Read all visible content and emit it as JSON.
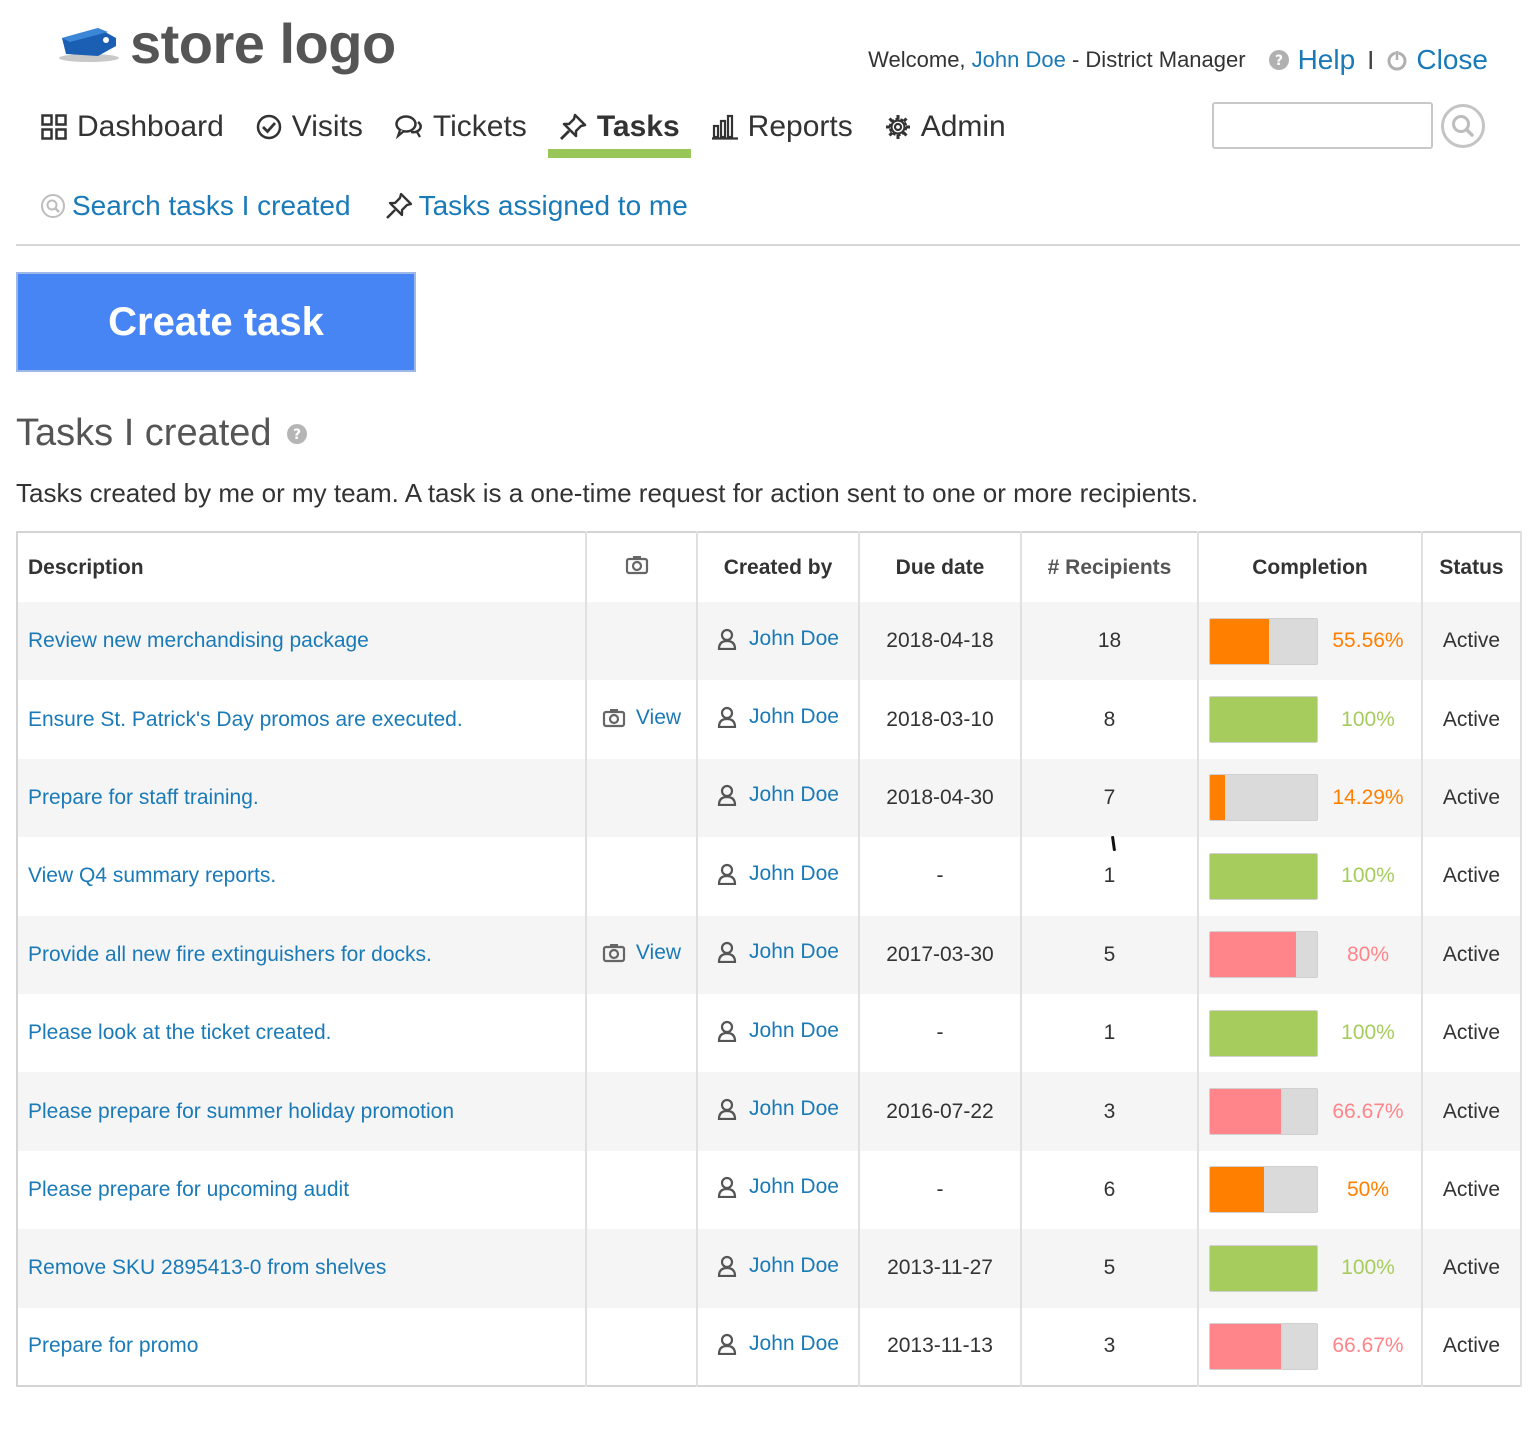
{
  "header": {
    "logo_text": "store logo",
    "welcome_prefix": "Welcome,",
    "user_name": "John Doe",
    "user_role": "- District Manager",
    "help_label": "Help",
    "separator": "I",
    "close_label": "Close"
  },
  "nav": {
    "items": [
      {
        "label": "Dashboard",
        "icon": "dashboard-grid-icon"
      },
      {
        "label": "Visits",
        "icon": "check-circle-icon"
      },
      {
        "label": "Tickets",
        "icon": "chat-bubbles-icon"
      },
      {
        "label": "Tasks",
        "icon": "pushpin-icon",
        "active": true
      },
      {
        "label": "Reports",
        "icon": "bar-chart-icon"
      },
      {
        "label": "Admin",
        "icon": "gear-icon"
      }
    ],
    "search_value": ""
  },
  "subnav": {
    "search_created_label": "Search tasks I created",
    "assigned_label": "Tasks assigned to me"
  },
  "create_button_label": "Create task",
  "section": {
    "title": "Tasks I created",
    "description": "Tasks created by me or my team. A task is a one-time request for action sent to one or more recipients."
  },
  "table": {
    "headers": {
      "description": "Description",
      "created_by": "Created by",
      "due_date": "Due date",
      "recipients": "# Recipients",
      "completion": "Completion",
      "status": "Status"
    },
    "colors": {
      "orange": "#ff7f00",
      "green": "#a5cc5c",
      "red": "#ff858a",
      "bar_bg": "#dadada"
    },
    "rows": [
      {
        "description": "Review new merchandising package",
        "view": "",
        "created_by": "John Doe",
        "due": "2018-04-18",
        "recipients": "18",
        "completion": 55.56,
        "completion_text": "55.56%",
        "color": "orange",
        "status": "Active"
      },
      {
        "description": "Ensure St. Patrick's Day promos are executed.",
        "view": "View",
        "created_by": "John Doe",
        "due": "2018-03-10",
        "recipients": "8",
        "completion": 100,
        "completion_text": "100%",
        "color": "green",
        "status": "Active"
      },
      {
        "description": "Prepare for staff training.",
        "view": "",
        "created_by": "John Doe",
        "due": "2018-04-30",
        "recipients": "7",
        "completion": 14.29,
        "completion_text": "14.29%",
        "color": "orange",
        "status": "Active"
      },
      {
        "description": "View Q4 summary reports.",
        "view": "",
        "created_by": "John Doe",
        "due": "-",
        "recipients": "1",
        "completion": 100,
        "completion_text": "100%",
        "color": "green",
        "status": "Active"
      },
      {
        "description": "Provide all new fire extinguishers for docks.",
        "view": "View",
        "created_by": "John Doe",
        "due": "2017-03-30",
        "recipients": "5",
        "completion": 80,
        "completion_text": "80%",
        "color": "red",
        "status": "Active"
      },
      {
        "description": "Please look at the ticket created.",
        "view": "",
        "created_by": "John Doe",
        "due": "-",
        "recipients": "1",
        "completion": 100,
        "completion_text": "100%",
        "color": "green",
        "status": "Active"
      },
      {
        "description": "Please prepare for summer holiday promotion",
        "view": "",
        "created_by": "John Doe",
        "due": "2016-07-22",
        "recipients": "3",
        "completion": 66.67,
        "completion_text": "66.67%",
        "color": "red",
        "status": "Active"
      },
      {
        "description": "Please prepare for upcoming audit",
        "view": "",
        "created_by": "John Doe",
        "due": "-",
        "recipients": "6",
        "completion": 50,
        "completion_text": "50%",
        "color": "orange",
        "status": "Active"
      },
      {
        "description": "Remove SKU 2895413-0 from shelves",
        "view": "",
        "created_by": "John Doe",
        "due": "2013-11-27",
        "recipients": "5",
        "completion": 100,
        "completion_text": "100%",
        "color": "green",
        "status": "Active"
      },
      {
        "description": "Prepare for promo",
        "view": "",
        "created_by": "John Doe",
        "due": "2013-11-13",
        "recipients": "3",
        "completion": 66.67,
        "completion_text": "66.67%",
        "color": "red",
        "status": "Active"
      }
    ]
  }
}
